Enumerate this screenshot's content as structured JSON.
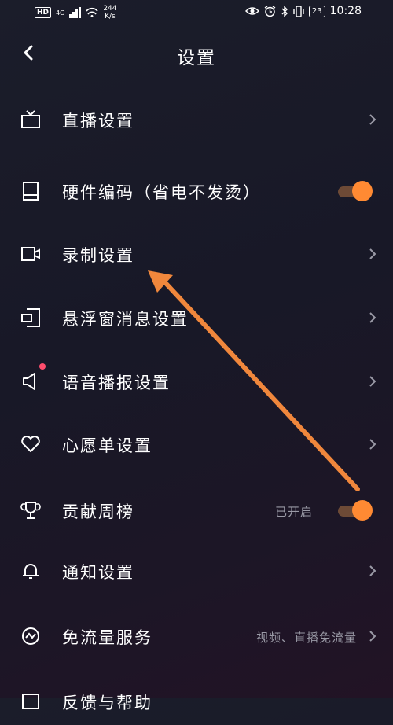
{
  "status_bar": {
    "hd": "HD",
    "network": "4G",
    "speed_value": "244",
    "speed_unit": "K/s",
    "battery": "23",
    "time": "10:28"
  },
  "header": {
    "title": "设置"
  },
  "settings": [
    {
      "label": "直播设置",
      "icon": "tv-icon",
      "control": "chevron"
    },
    {
      "label": "硬件编码（省电不发烫）",
      "icon": "device-icon",
      "control": "toggle",
      "toggle_on": true
    },
    {
      "label": "录制设置",
      "icon": "video-camera-icon",
      "control": "chevron"
    },
    {
      "label": "悬浮窗消息设置",
      "icon": "floating-window-icon",
      "control": "chevron"
    },
    {
      "label": "语音播报设置",
      "icon": "speaker-icon",
      "control": "chevron",
      "badge_dot": true
    },
    {
      "label": "心愿单设置",
      "icon": "heart-icon",
      "control": "chevron"
    },
    {
      "label": "贡献周榜",
      "icon": "trophy-icon",
      "control": "toggle",
      "value": "已开启",
      "toggle_on": true
    },
    {
      "label": "通知设置",
      "icon": "bell-icon",
      "control": "chevron"
    },
    {
      "label": "免流量服务",
      "icon": "data-free-icon",
      "control": "chevron",
      "value": "视频、直播免流量"
    },
    {
      "label": "反馈与帮助",
      "icon": "feedback-icon",
      "control": "chevron"
    }
  ],
  "colors": {
    "accent": "#ff8a33",
    "toggle_track": "#6d4a36",
    "secondary_text": "#9a9aa6",
    "badge": "#ff4d6d",
    "annotation_arrow": "#f0873c"
  }
}
